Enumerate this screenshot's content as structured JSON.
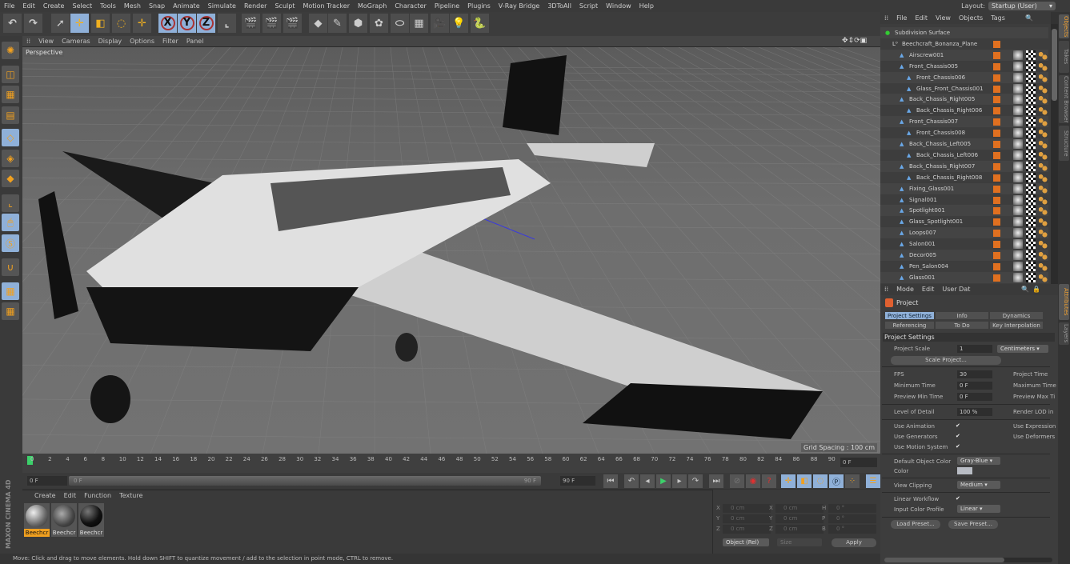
{
  "menubar": {
    "items": [
      "File",
      "Edit",
      "Create",
      "Select",
      "Tools",
      "Mesh",
      "Snap",
      "Animate",
      "Simulate",
      "Render",
      "Sculpt",
      "Motion Tracker",
      "MoGraph",
      "Character",
      "Pipeline",
      "Plugins",
      "V-Ray Bridge",
      "3DToAll",
      "Script",
      "Window",
      "Help"
    ]
  },
  "layout": {
    "label": "Layout:",
    "value": "Startup (User)"
  },
  "toolbar": {
    "icons": [
      "undo-icon",
      "redo-icon",
      "live-selection-icon",
      "move-icon",
      "scale-icon",
      "rotate-icon",
      "recent-tool-icon",
      "x-axis-lock-icon",
      "y-axis-lock-icon",
      "z-axis-lock-icon",
      "coordinate-system-icon",
      "render-view-icon",
      "render-picture-viewer-icon",
      "edit-render-settings-icon",
      "cube-icon",
      "pen-icon",
      "subdivision-icon",
      "array-icon",
      "deformer-icon",
      "floor-icon",
      "camera-icon",
      "light-icon",
      "python-icon"
    ],
    "axis_labels": [
      "X",
      "Y",
      "Z"
    ]
  },
  "viewport": {
    "menu": [
      "View",
      "Cameras",
      "Display",
      "Options",
      "Filter",
      "Panel"
    ],
    "camera_label": "Perspective",
    "grid_spacing": "Grid Spacing : 100 cm"
  },
  "timeline": {
    "ticks": [
      "0",
      "2",
      "4",
      "6",
      "8",
      "10",
      "12",
      "14",
      "16",
      "18",
      "20",
      "22",
      "24",
      "26",
      "28",
      "30",
      "32",
      "34",
      "36",
      "38",
      "40",
      "42",
      "44",
      "46",
      "48",
      "50",
      "52",
      "54",
      "56",
      "58",
      "60",
      "62",
      "64",
      "66",
      "68",
      "70",
      "72",
      "74",
      "76",
      "78",
      "80",
      "82",
      "84",
      "86",
      "88",
      "90"
    ],
    "current_frame": "0 F",
    "start_field": "0 F",
    "slider_start": "0 F",
    "slider_end": "90 F",
    "end_field": "90 F"
  },
  "materials": {
    "menu": [
      "Create",
      "Edit",
      "Function",
      "Texture"
    ],
    "items": [
      {
        "label": "Beechcr"
      },
      {
        "label": "Beechcr"
      },
      {
        "label": "Beechcr"
      }
    ]
  },
  "coordinates": {
    "header": [
      "--",
      "--",
      "--"
    ],
    "rows": [
      {
        "a": "X",
        "av": "0 cm",
        "b": "X",
        "bv": "0 cm",
        "c": "H",
        "cv": "0 °"
      },
      {
        "a": "Y",
        "av": "0 cm",
        "b": "Y",
        "bv": "0 cm",
        "c": "P",
        "cv": "0 °"
      },
      {
        "a": "Z",
        "av": "0 cm",
        "b": "Z",
        "bv": "0 cm",
        "c": "B",
        "cv": "0 °"
      }
    ],
    "mode": "Object (Rel)",
    "size_mode": "Size",
    "apply": "Apply"
  },
  "status": "Move: Click and drag to move elements. Hold down SHIFT to quantize movement / add to the selection in point mode, CTRL to remove.",
  "logo": "MAXON CINEMA 4D",
  "object_manager": {
    "menu": [
      "File",
      "Edit",
      "View",
      "Objects",
      "Tags"
    ],
    "objects": [
      {
        "name": "Subdivision Surface",
        "depth": 0
      },
      {
        "name": "Beechcraft_Bonanza_Plane",
        "depth": 1
      },
      {
        "name": "Airscrew001",
        "depth": 2
      },
      {
        "name": "Front_Chassis005",
        "depth": 2
      },
      {
        "name": "Front_Chassis006",
        "depth": 3
      },
      {
        "name": "Glass_Front_Chassis001",
        "depth": 3
      },
      {
        "name": "Back_Chassis_Right005",
        "depth": 2
      },
      {
        "name": "Back_Chassis_Right006",
        "depth": 3
      },
      {
        "name": "Front_Chassis007",
        "depth": 2
      },
      {
        "name": "Front_Chassis008",
        "depth": 3
      },
      {
        "name": "Back_Chassis_Left005",
        "depth": 2
      },
      {
        "name": "Back_Chassis_Left006",
        "depth": 3
      },
      {
        "name": "Back_Chassis_Right007",
        "depth": 2
      },
      {
        "name": "Back_Chassis_Right008",
        "depth": 3
      },
      {
        "name": "Fixing_Glass001",
        "depth": 2
      },
      {
        "name": "Signal001",
        "depth": 2
      },
      {
        "name": "Spotlight001",
        "depth": 2
      },
      {
        "name": "Glass_Spotlight001",
        "depth": 2
      },
      {
        "name": "Loops007",
        "depth": 2
      },
      {
        "name": "Salon001",
        "depth": 2
      },
      {
        "name": "Decor005",
        "depth": 2
      },
      {
        "name": "Pen_Salon004",
        "depth": 2
      },
      {
        "name": "Glass001",
        "depth": 2
      }
    ]
  },
  "side_tabs": {
    "top": [
      "Objects",
      "Takes",
      "Content Browser",
      "Structure"
    ],
    "bottom": [
      "Attributes",
      "Layers"
    ]
  },
  "attributes": {
    "menu": [
      "Mode",
      "Edit",
      "User Dat"
    ],
    "title": "Project",
    "tabs": [
      [
        "Project Settings",
        "Info",
        "Dynamics"
      ],
      [
        "Referencing",
        "To Do",
        "Key Interpolation"
      ]
    ],
    "section": "Project Settings",
    "project_scale": {
      "label": "Project Scale",
      "value": "1",
      "unit": "Centimeters"
    },
    "scale_button": "Scale Project...",
    "fps": {
      "label": "FPS",
      "value": "30"
    },
    "min_time": {
      "label": "Minimum Time",
      "value": "0 F"
    },
    "preview_min": {
      "label": "Preview Min Time",
      "value": "0 F"
    },
    "lod": {
      "label": "Level of Detail",
      "value": "100 %"
    },
    "right_labels": [
      "Project Time",
      "Maximum Time",
      "Preview Max Ti",
      "Render LOD in",
      "Use Expression",
      "Use Deformers"
    ],
    "use_animation": "Use Animation",
    "use_generators": "Use Generators",
    "use_motion": "Use Motion System",
    "default_color": {
      "label": "Default Object Color",
      "value": "Gray-Blue"
    },
    "color_label": "Color",
    "view_clipping": {
      "label": "View Clipping",
      "value": "Medium"
    },
    "linear_workflow": "Linear Workflow",
    "input_profile": {
      "label": "Input Color Profile",
      "value": "Linear"
    },
    "load_preset": "Load Preset...",
    "save_preset": "Save Preset..."
  }
}
